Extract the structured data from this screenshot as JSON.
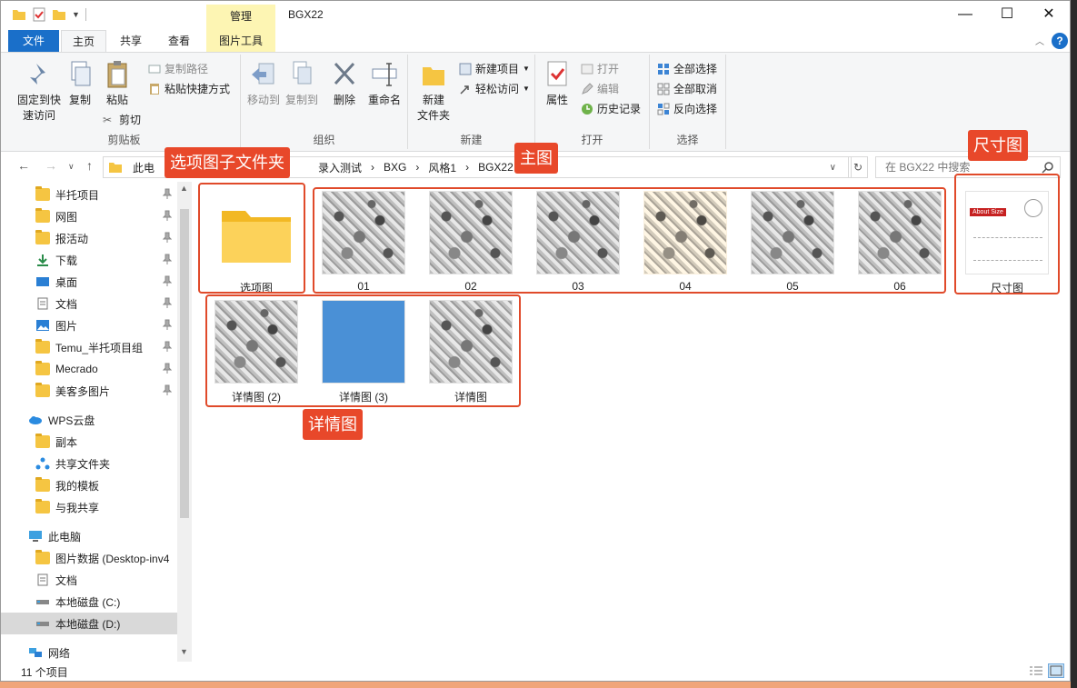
{
  "window": {
    "title": "BGX22",
    "manage_tab": "管理",
    "min": "—",
    "max": "☐",
    "close": "✕"
  },
  "ribbon_tabs": [
    "文件",
    "主页",
    "共享",
    "查看",
    "图片工具"
  ],
  "ribbon": {
    "clipboard": {
      "label": "剪贴板",
      "pin_quick_1": "固定到快",
      "pin_quick_2": "速访问",
      "copy": "复制",
      "paste": "粘贴",
      "copy_path": "复制路径",
      "paste_shortcut": "粘贴快捷方式",
      "cut": "剪切"
    },
    "organize": {
      "label": "组织",
      "move_to": "移动到",
      "copy_to": "复制到",
      "delete": "删除",
      "rename": "重命名"
    },
    "new": {
      "label": "新建",
      "new_folder_1": "新建",
      "new_folder_2": "文件夹",
      "new_item": "新建项目",
      "easy_access": "轻松访问"
    },
    "open": {
      "label": "打开",
      "properties": "属性",
      "open": "打开",
      "edit": "编辑",
      "history": "历史记录"
    },
    "select": {
      "label": "选择",
      "select_all": "全部选择",
      "select_none": "全部取消",
      "invert": "反向选择"
    }
  },
  "address": {
    "crumbs": [
      "此电",
      "录入测试",
      "BXG",
      "风格1",
      "BGX22"
    ],
    "search_placeholder": "在 BGX22 中搜索"
  },
  "nav_items": [
    {
      "label": "半托项目",
      "icon": "folder-icon",
      "pinned": true
    },
    {
      "label": "网图",
      "icon": "folder-icon",
      "pinned": true
    },
    {
      "label": "报活动",
      "icon": "folder-icon",
      "pinned": true
    },
    {
      "label": "下载",
      "icon": "download-icon",
      "pinned": true
    },
    {
      "label": "桌面",
      "icon": "desktop-icon",
      "pinned": true
    },
    {
      "label": "文档",
      "icon": "document-icon",
      "pinned": true
    },
    {
      "label": "图片",
      "icon": "pictures-icon",
      "pinned": true
    },
    {
      "label": "Temu_半托项目组",
      "icon": "folder-icon",
      "pinned": true
    },
    {
      "label": "Mecrado",
      "icon": "folder-icon",
      "pinned": true
    },
    {
      "label": "美客多图片",
      "icon": "folder-icon",
      "pinned": true
    },
    {
      "label": "WPS云盘",
      "icon": "cloud-icon",
      "pinned": false
    },
    {
      "label": "副本",
      "icon": "folder-icon",
      "pinned": false
    },
    {
      "label": "共享文件夹",
      "icon": "share-icon",
      "pinned": false
    },
    {
      "label": "我的模板",
      "icon": "folder-icon",
      "pinned": false
    },
    {
      "label": "与我共享",
      "icon": "folder-icon",
      "pinned": false
    },
    {
      "label": "此电脑",
      "icon": "computer-icon",
      "pinned": false
    },
    {
      "label": "图片数据 (Desktop-inv4",
      "icon": "folder-icon",
      "pinned": false
    },
    {
      "label": "文档",
      "icon": "document-icon",
      "pinned": false
    },
    {
      "label": "本地磁盘 (C:)",
      "icon": "disk-icon",
      "pinned": false
    },
    {
      "label": "本地磁盘 (D:)",
      "icon": "disk-icon",
      "pinned": false,
      "selected": true
    },
    {
      "label": "网络",
      "icon": "network-icon",
      "pinned": false
    }
  ],
  "files": [
    {
      "name": "选项图",
      "type": "folder"
    },
    {
      "name": "01",
      "type": "image"
    },
    {
      "name": "02",
      "type": "image"
    },
    {
      "name": "03",
      "type": "image"
    },
    {
      "name": "04",
      "type": "image"
    },
    {
      "name": "05",
      "type": "image"
    },
    {
      "name": "06",
      "type": "image"
    },
    {
      "name": "尺寸图",
      "type": "image",
      "inner_text": "About Size"
    },
    {
      "name": "详情图 (2)",
      "type": "image"
    },
    {
      "name": "详情图 (3)",
      "type": "image"
    },
    {
      "name": "详情图",
      "type": "image"
    }
  ],
  "annotations": {
    "folder": "选项图子文件夹",
    "main": "主图",
    "size": "尺寸图",
    "detail": "详情图"
  },
  "status": {
    "count": "11 个项目"
  },
  "colors": {
    "accent": "#1a6fc9",
    "annotation": "#e8482a",
    "tool_tab": "#fdf5b3"
  }
}
